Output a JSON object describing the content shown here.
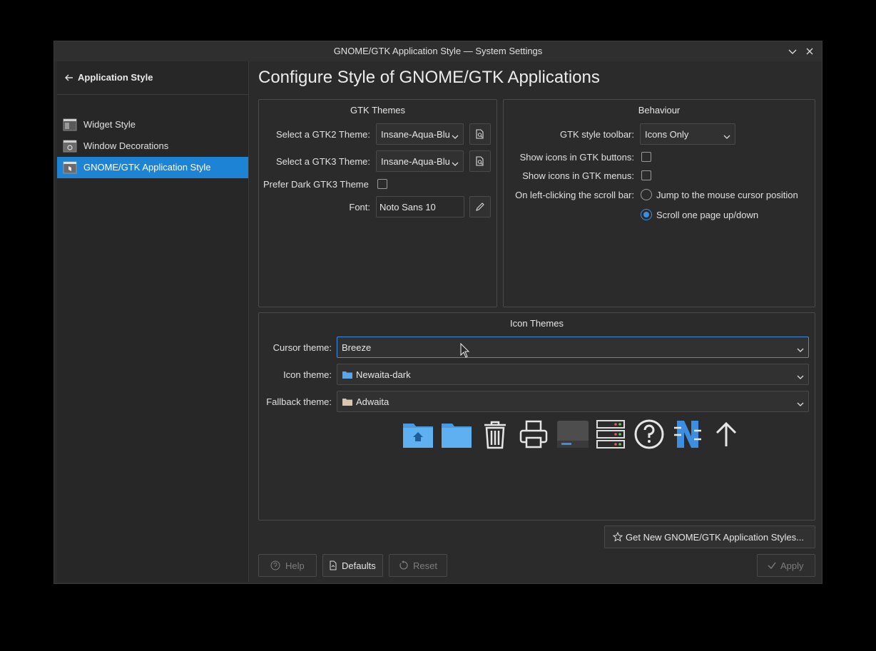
{
  "window": {
    "title": "GNOME/GTK Application Style — System Settings"
  },
  "sidebar": {
    "back_label": "Application Style",
    "items": [
      {
        "label": "Widget Style",
        "icon": "widget-style-icon",
        "active": false
      },
      {
        "label": "Window Decorations",
        "icon": "window-decorations-icon",
        "active": false
      },
      {
        "label": "GNOME/GTK Application Style",
        "icon": "gtk-style-icon",
        "active": true
      }
    ]
  },
  "main": {
    "title": "Configure Style of GNOME/GTK Applications",
    "gtk_themes": {
      "title": "GTK Themes",
      "gtk2_label": "Select a GTK2 Theme:",
      "gtk2_value": "Insane-Aqua-Blu",
      "gtk3_label": "Select a GTK3 Theme:",
      "gtk3_value": "Insane-Aqua-Blu",
      "prefer_dark_label": "Prefer Dark GTK3 Theme",
      "prefer_dark_checked": false,
      "font_label": "Font:",
      "font_value": "Noto Sans 10"
    },
    "behaviour": {
      "title": "Behaviour",
      "toolbar_label": "GTK style toolbar:",
      "toolbar_value": "Icons Only",
      "icons_buttons_label": "Show icons in GTK buttons:",
      "icons_buttons_checked": false,
      "icons_menus_label": "Show icons in GTK menus:",
      "icons_menus_checked": false,
      "scrollbar_label": "On left-clicking the scroll bar:",
      "scrollbar_option1": "Jump to the mouse cursor position",
      "scrollbar_option2": "Scroll one page up/down",
      "scrollbar_selected": "Scroll one page up/down"
    },
    "icon_themes": {
      "title": "Icon Themes",
      "cursor_label": "Cursor theme:",
      "cursor_value": "Breeze",
      "icon_label": "Icon theme:",
      "icon_value": "Newaita-dark",
      "fallback_label": "Fallback theme:",
      "fallback_value": "Adwaita",
      "preview_icons": [
        "user-home-icon",
        "folder-icon",
        "trash-icon",
        "printer-icon",
        "drive-icon",
        "server-icon",
        "help-icon",
        "app-n-icon",
        "go-up-icon"
      ]
    },
    "get_new_button": "Get New GNOME/GTK Application Styles..."
  },
  "footer": {
    "help": "Help",
    "defaults": "Defaults",
    "reset": "Reset",
    "apply": "Apply"
  },
  "colors": {
    "accent": "#1d83d4",
    "window_bg": "#2b2b2b",
    "text": "#e6e6e6"
  }
}
